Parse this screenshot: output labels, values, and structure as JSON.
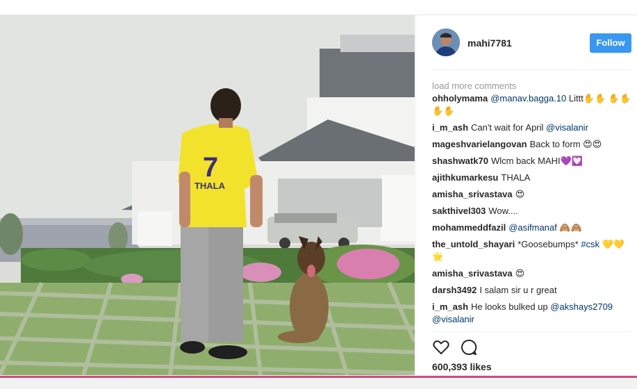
{
  "post": {
    "username": "mahi7781",
    "follow_label": "Follow",
    "load_more": "load more comments",
    "likes": "600,393 likes",
    "jersey_number": "7",
    "jersey_name": "THALA"
  },
  "comments": [
    {
      "user": "ohholymama",
      "mention": "@manav.bagga.10",
      "text": " Littt✋✋ ✋✋✋✋"
    },
    {
      "user": "i_m_ash",
      "text": "Can't wait for April ",
      "mention": "@visalanir"
    },
    {
      "user": "mageshvarielangovan",
      "text": "Back to form 😍😍"
    },
    {
      "user": "shashwatk70",
      "text": "Wlcm back MAHI💜💟"
    },
    {
      "user": "ajithkumarkesu",
      "text": "THALA"
    },
    {
      "user": "amisha_srivastava",
      "text": "😍"
    },
    {
      "user": "sakthivel303",
      "text": "Wow...."
    },
    {
      "user": "mohammeddfazil",
      "mention": "@asifmanaf",
      "text": " 🙈🙈"
    },
    {
      "user": "the_untold_shayari",
      "text": "*Goosebumps* ",
      "mention": "#csk",
      "after": " 💛💛🌟"
    },
    {
      "user": "amisha_srivastava",
      "text": "😍"
    },
    {
      "user": "darsh3492",
      "text": "I salam sir u r great"
    },
    {
      "user": "i_m_ash",
      "text": "He looks bulked up ",
      "mention": "@akshays2709",
      "after": " @visalanir"
    }
  ],
  "icons": {
    "like": "heart-icon",
    "comment": "comment-bubble-icon"
  },
  "colors": {
    "follow_button": "#3897f0",
    "jersey": "#f3e22b",
    "jersey_text": "#3c2f7a",
    "bottom_accent": "#d4497d"
  }
}
